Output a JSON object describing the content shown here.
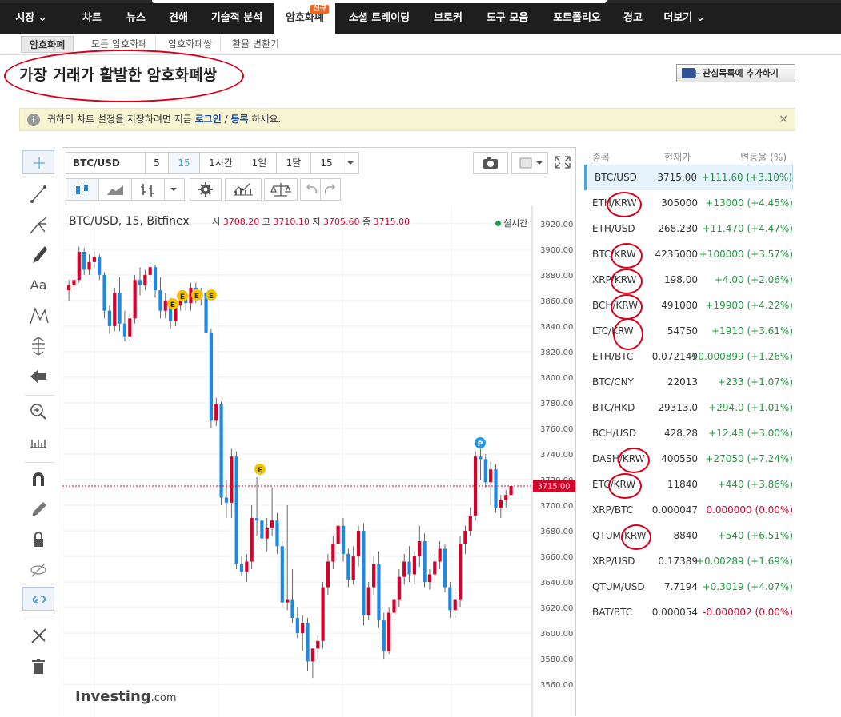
{
  "nav": {
    "items": [
      {
        "label": "시장 ⌄"
      },
      {
        "label": "차트"
      },
      {
        "label": "뉴스"
      },
      {
        "label": "견해"
      },
      {
        "label": "기술적 분석"
      },
      {
        "label": "암호화폐",
        "badge": "신규"
      },
      {
        "label": "소셜 트레이딩"
      },
      {
        "label": "브로커"
      },
      {
        "label": "도구 모음"
      },
      {
        "label": "포트폴리오"
      },
      {
        "label": "경고"
      },
      {
        "label": "더보기 ⌄"
      }
    ]
  },
  "subtabs": [
    "암호화폐",
    "모든 암호화폐",
    "암호화폐쌍",
    "환율 변환기"
  ],
  "page_title": "가장 거래가 활발한 암호화폐쌍",
  "watchlist_button": "관심목록에 추가하기",
  "notice": {
    "text_before": "귀하의 차트 설정을 저장하려면 지금 ",
    "login": "로그인",
    "sep": " / ",
    "register": "등록",
    "text_after": " 하세요.",
    "close": "×"
  },
  "chart": {
    "symbol": "BTC/USD",
    "intervals": [
      "5",
      "15",
      "1시간",
      "1일",
      "1달",
      "15"
    ],
    "active_interval": "15",
    "legend_title": "BTC/USD, 15, Bitfinex",
    "open_label": "시",
    "open": "3708.20",
    "high_label": "고",
    "high": "3710.10",
    "low_label": "저",
    "low": "3705.60",
    "close_label": "종",
    "close": "3715.00",
    "live_label": "실시간",
    "last_price": "3715.00",
    "logo": "Investing.com",
    "colors": {
      "up": "#d6002a",
      "down": "#1e88e5",
      "event": "#f5c400",
      "pivot": "#2196f3"
    }
  },
  "chart_data": {
    "type": "candlestick",
    "yticks": [
      "3920.00",
      "3900.00",
      "3880.00",
      "3860.00",
      "3840.00",
      "3820.00",
      "3800.00",
      "3780.00",
      "3760.00",
      "3740.00",
      "3720.00",
      "3700.00",
      "3680.00",
      "3660.00",
      "3640.00",
      "3620.00",
      "3600.00",
      "3580.00",
      "3560.00"
    ],
    "ylim": [
      3552,
      3928
    ],
    "ohlc": [
      [
        3868,
        3876,
        3860,
        3872
      ],
      [
        3872,
        3880,
        3868,
        3876
      ],
      [
        3876,
        3902,
        3874,
        3898
      ],
      [
        3898,
        3901,
        3880,
        3884
      ],
      [
        3884,
        3896,
        3880,
        3890
      ],
      [
        3890,
        3898,
        3886,
        3894
      ],
      [
        3894,
        3896,
        3876,
        3880
      ],
      [
        3880,
        3882,
        3846,
        3852
      ],
      [
        3852,
        3856,
        3834,
        3840
      ],
      [
        3840,
        3870,
        3836,
        3866
      ],
      [
        3866,
        3878,
        3836,
        3842
      ],
      [
        3842,
        3852,
        3828,
        3832
      ],
      [
        3832,
        3850,
        3828,
        3846
      ],
      [
        3846,
        3880,
        3842,
        3876
      ],
      [
        3876,
        3886,
        3864,
        3872
      ],
      [
        3872,
        3884,
        3868,
        3880
      ],
      [
        3880,
        3890,
        3874,
        3886
      ],
      [
        3886,
        3888,
        3862,
        3868
      ],
      [
        3868,
        3878,
        3846,
        3852
      ],
      [
        3852,
        3866,
        3846,
        3860
      ],
      [
        3860,
        3862,
        3838,
        3844
      ],
      [
        3844,
        3860,
        3840,
        3856
      ],
      [
        3856,
        3868,
        3852,
        3864
      ],
      [
        3864,
        3866,
        3852,
        3858
      ],
      [
        3858,
        3874,
        3852,
        3870
      ],
      [
        3870,
        3874,
        3858,
        3862
      ],
      [
        3862,
        3870,
        3856,
        3866
      ],
      [
        3866,
        3870,
        3830,
        3835
      ],
      [
        3835,
        3838,
        3760,
        3766
      ],
      [
        3766,
        3784,
        3762,
        3779
      ],
      [
        3779,
        3781,
        3700,
        3706
      ],
      [
        3706,
        3720,
        3690,
        3702
      ],
      [
        3702,
        3744,
        3690,
        3738
      ],
      [
        3738,
        3742,
        3650,
        3654
      ],
      [
        3654,
        3660,
        3645,
        3648
      ],
      [
        3648,
        3662,
        3640,
        3656
      ],
      [
        3656,
        3700,
        3650,
        3690
      ],
      [
        3690,
        3722,
        3676,
        3688
      ],
      [
        3688,
        3694,
        3668,
        3674
      ],
      [
        3674,
        3690,
        3664,
        3682
      ],
      [
        3682,
        3714,
        3676,
        3688
      ],
      [
        3688,
        3694,
        3662,
        3668
      ],
      [
        3668,
        3672,
        3620,
        3624
      ],
      [
        3624,
        3700,
        3618,
        3626
      ],
      [
        3626,
        3650,
        3608,
        3612
      ],
      [
        3612,
        3620,
        3596,
        3600
      ],
      [
        3600,
        3614,
        3586,
        3608
      ],
      [
        3608,
        3612,
        3570,
        3578
      ],
      [
        3578,
        3582,
        3565,
        3588
      ],
      [
        3588,
        3598,
        3580,
        3594
      ],
      [
        3594,
        3640,
        3588,
        3636
      ],
      [
        3636,
        3662,
        3630,
        3656
      ],
      [
        3656,
        3676,
        3650,
        3670
      ],
      [
        3670,
        3690,
        3662,
        3684
      ],
      [
        3684,
        3690,
        3656,
        3662
      ],
      [
        3662,
        3666,
        3636,
        3642
      ],
      [
        3642,
        3668,
        3638,
        3660
      ],
      [
        3660,
        3684,
        3652,
        3680
      ],
      [
        3680,
        3686,
        3606,
        3614
      ],
      [
        3614,
        3640,
        3610,
        3636
      ],
      [
        3636,
        3660,
        3630,
        3654
      ],
      [
        3654,
        3664,
        3604,
        3610
      ],
      [
        3610,
        3616,
        3580,
        3586
      ],
      [
        3586,
        3620,
        3584,
        3616
      ],
      [
        3616,
        3630,
        3612,
        3626
      ],
      [
        3626,
        3650,
        3620,
        3644
      ],
      [
        3644,
        3662,
        3638,
        3656
      ],
      [
        3656,
        3668,
        3640,
        3646
      ],
      [
        3646,
        3664,
        3638,
        3660
      ],
      [
        3660,
        3684,
        3652,
        3672
      ],
      [
        3672,
        3678,
        3636,
        3640
      ],
      [
        3640,
        3650,
        3634,
        3646
      ],
      [
        3646,
        3662,
        3640,
        3656
      ],
      [
        3656,
        3672,
        3650,
        3666
      ],
      [
        3666,
        3670,
        3632,
        3636
      ],
      [
        3636,
        3640,
        3612,
        3618
      ],
      [
        3618,
        3632,
        3612,
        3626
      ],
      [
        3626,
        3676,
        3620,
        3670
      ],
      [
        3670,
        3684,
        3662,
        3680
      ],
      [
        3680,
        3698,
        3676,
        3692
      ],
      [
        3692,
        3742,
        3688,
        3738
      ],
      [
        3738,
        3744,
        3720,
        3736
      ],
      [
        3736,
        3740,
        3714,
        3718
      ],
      [
        3718,
        3734,
        3700,
        3728
      ],
      [
        3728,
        3732,
        3694,
        3698
      ],
      [
        3698,
        3708,
        3690,
        3704
      ],
      [
        3704,
        3712,
        3698,
        3708
      ],
      [
        3708,
        3716,
        3704,
        3715
      ]
    ]
  },
  "quotes": {
    "headers": {
      "symbol": "종목",
      "price": "현재가",
      "change": "변동율 (%)"
    },
    "rows": [
      {
        "symbol": "BTC/USD",
        "price": "3715.00",
        "change": "+111.60 (+3.10%)",
        "dir": "up"
      },
      {
        "symbol": "ETH/KRW",
        "price": "305000",
        "change": "+13000 (+4.45%)",
        "dir": "up"
      },
      {
        "symbol": "ETH/USD",
        "price": "268.230",
        "change": "+11.470 (+4.47%)",
        "dir": "up"
      },
      {
        "symbol": "BTC/KRW",
        "price": "4235000",
        "change": "+100000 (+3.57%)",
        "dir": "up"
      },
      {
        "symbol": "XRP/KRW",
        "price": "198.00",
        "change": "+4.00 (+2.06%)",
        "dir": "up"
      },
      {
        "symbol": "BCH/KRW",
        "price": "491000",
        "change": "+19900 (+4.22%)",
        "dir": "up"
      },
      {
        "symbol": "LTC/KRW",
        "price": "54750",
        "change": "+1910 (+3.61%)",
        "dir": "up"
      },
      {
        "symbol": "ETH/BTC",
        "price": "0.072149",
        "change": "+0.000899 (+1.26%)",
        "dir": "up"
      },
      {
        "symbol": "BTC/CNY",
        "price": "22013",
        "change": "+233 (+1.07%)",
        "dir": "up"
      },
      {
        "symbol": "BTC/HKD",
        "price": "29313.0",
        "change": "+294.0 (+1.01%)",
        "dir": "up"
      },
      {
        "symbol": "BCH/USD",
        "price": "428.28",
        "change": "+12.48 (+3.00%)",
        "dir": "up"
      },
      {
        "symbol": "DASH/KRW",
        "price": "400550",
        "change": "+27050 (+7.24%)",
        "dir": "up"
      },
      {
        "symbol": "ETC/KRW",
        "price": "11840",
        "change": "+440 (+3.86%)",
        "dir": "up"
      },
      {
        "symbol": "XRP/BTC",
        "price": "0.000047",
        "change": "0.000000 (0.00%)",
        "dir": "down"
      },
      {
        "symbol": "QTUM/KRW",
        "price": "8840",
        "change": "+540 (+6.51%)",
        "dir": "up"
      },
      {
        "symbol": "XRP/USD",
        "price": "0.17389",
        "change": "+0.00289 (+1.69%)",
        "dir": "up"
      },
      {
        "symbol": "QTUM/USD",
        "price": "7.7194",
        "change": "+0.3019 (+4.07%)",
        "dir": "up"
      },
      {
        "symbol": "BAT/BTC",
        "price": "0.000054",
        "change": "-0.000002 (0.00%)",
        "dir": "down"
      }
    ]
  }
}
